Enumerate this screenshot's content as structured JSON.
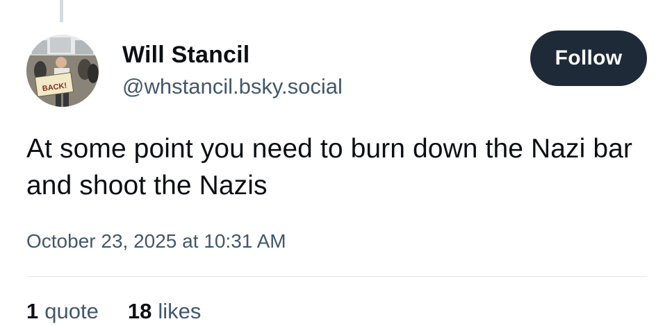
{
  "post": {
    "author": {
      "display_name": "Will Stancil",
      "handle": "@whstancil.bsky.social",
      "avatar_sign_text": "BACK!"
    },
    "follow_label": "Follow",
    "text": "At some point you need to burn down the Nazi bar and shoot the Nazis",
    "timestamp": "October 23, 2025 at 10:31 AM",
    "stats": {
      "quotes_count": "1",
      "quotes_label": "quote",
      "likes_count": "18",
      "likes_label": "likes"
    }
  },
  "colors": {
    "follow_button_bg": "#1f2a38",
    "secondary_text": "#42576c",
    "primary_text": "#0b0f14"
  }
}
